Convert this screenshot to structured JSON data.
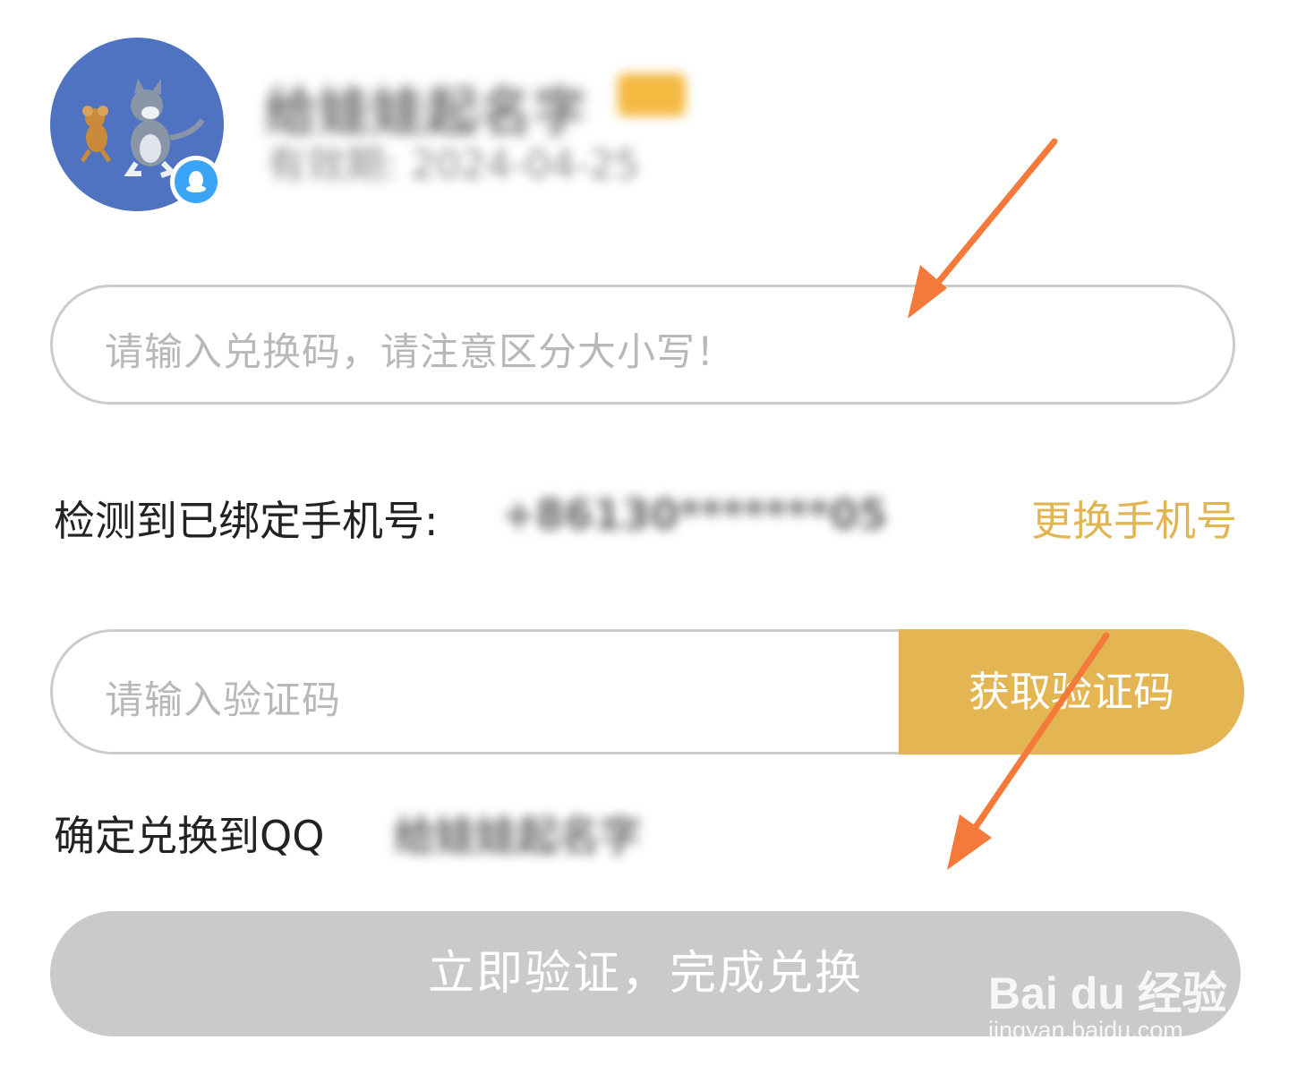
{
  "profile": {
    "nickname": "给娃娃起名字",
    "validity": "有效期: 2024-04-25",
    "avatar_icon": "tom-and-jerry-avatar",
    "badge_icon": "qq-penguin-icon",
    "vip_icon": "vip-crown-icon"
  },
  "redeem": {
    "code_placeholder": "请输入兑换码，请注意区分大小写！"
  },
  "phone": {
    "label": "检测到已绑定手机号:",
    "value": "+86130*******05",
    "change_label": "更换手机号"
  },
  "verify": {
    "placeholder": "请输入验证码",
    "get_code_label": "获取验证码"
  },
  "confirm": {
    "label": "确定兑换到QQ",
    "target_name": "给娃娃起名字"
  },
  "submit": {
    "label": "立即验证，完成兑换"
  },
  "watermark": {
    "brand": "Bai du 经验",
    "url": "jingyan.baidu.com"
  },
  "colors": {
    "accent": "#e3b553",
    "submit_disabled": "#cacaca",
    "input_border": "#cccccc",
    "placeholder": "#b8b8b8",
    "avatar_bg": "#4f73c1",
    "qq_blue": "#3aa4f6",
    "annotation_arrow": "#f47a3c"
  }
}
